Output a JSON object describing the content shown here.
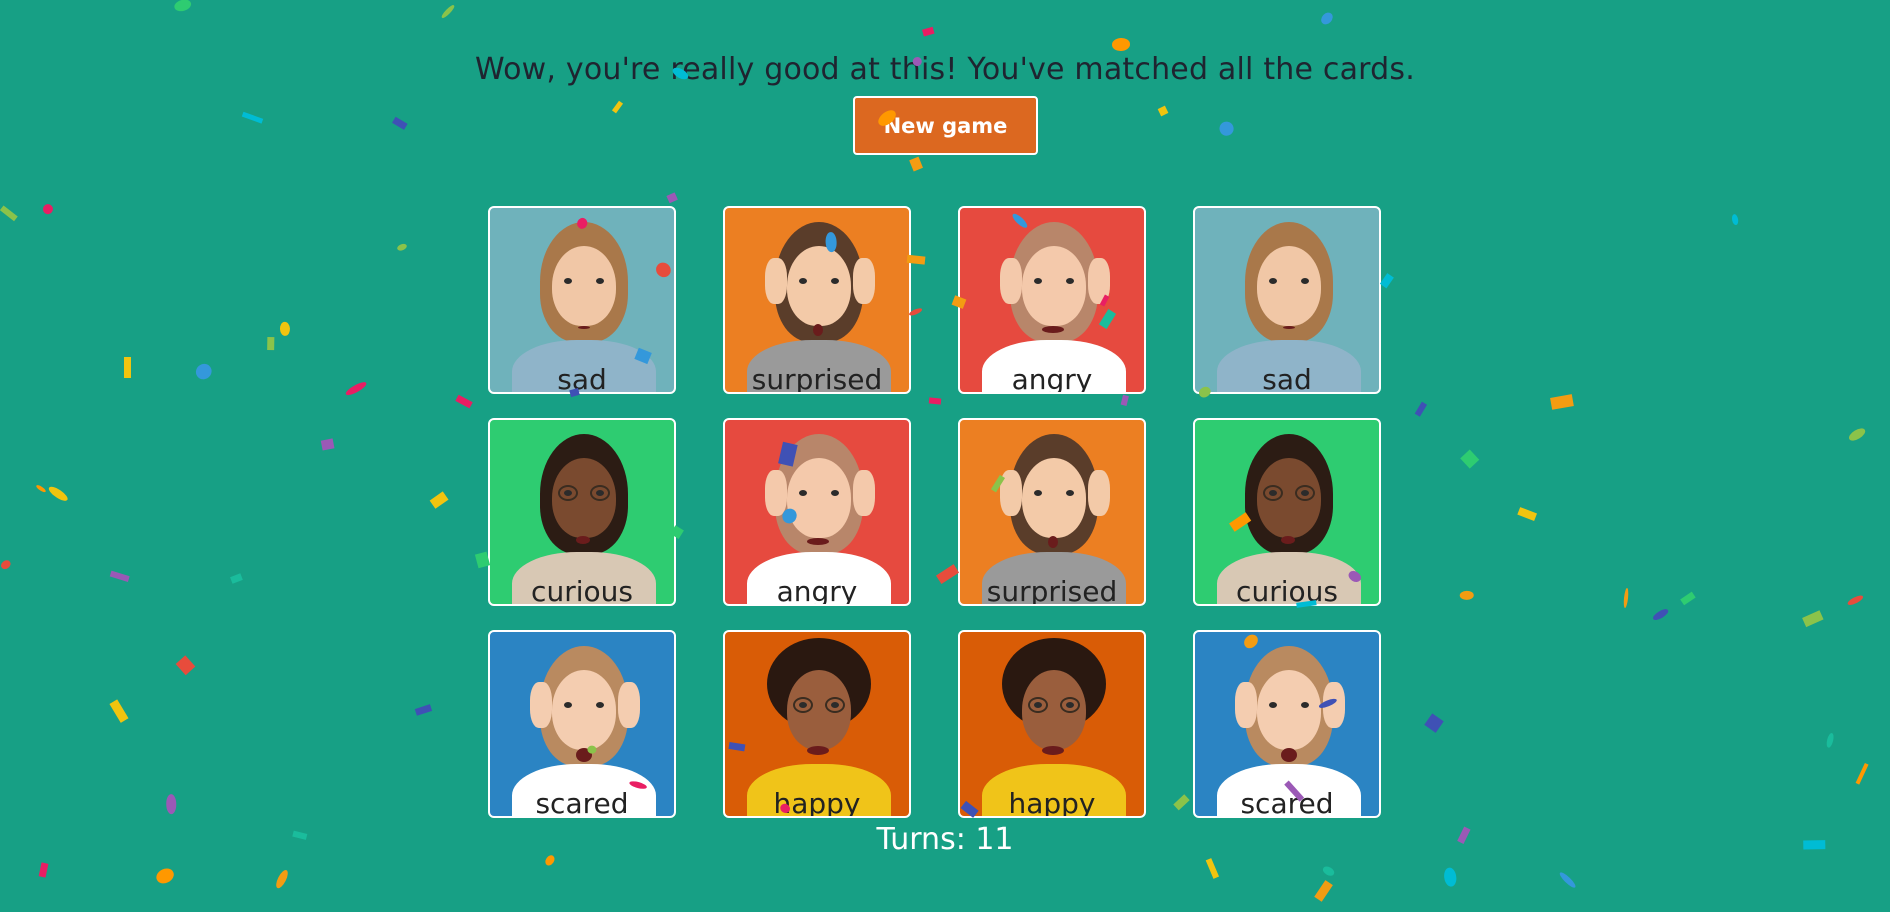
{
  "message": "Wow, you're really good at this! You've matched all the cards.",
  "new_game_label": "New game",
  "turns_label": "Turns: 11",
  "colors": {
    "background": "#17a085",
    "button": "#dc6820",
    "text_dark": "#1f2430",
    "card_border": "#ffffff"
  },
  "cards": [
    {
      "label": "sad",
      "bg": "#6fb2bb",
      "kind": "girl-sad",
      "matched": true
    },
    {
      "label": "surprised",
      "bg": "#ec7f22",
      "kind": "boy-surprised",
      "matched": true
    },
    {
      "label": "angry",
      "bg": "#e64a3f",
      "kind": "girl-angry",
      "matched": true
    },
    {
      "label": "sad",
      "bg": "#6fb2bb",
      "kind": "girl-sad",
      "matched": true
    },
    {
      "label": "curious",
      "bg": "#2ecc71",
      "kind": "man-curious",
      "matched": true
    },
    {
      "label": "angry",
      "bg": "#e64a3f",
      "kind": "girl-angry",
      "matched": true
    },
    {
      "label": "surprised",
      "bg": "#ec7f22",
      "kind": "boy-surprised",
      "matched": true
    },
    {
      "label": "curious",
      "bg": "#2ecc71",
      "kind": "man-curious",
      "matched": true
    },
    {
      "label": "scared",
      "bg": "#2b84c3",
      "kind": "boy-scared",
      "matched": true
    },
    {
      "label": "happy",
      "bg": "#d95c06",
      "kind": "woman-happy",
      "matched": true
    },
    {
      "label": "happy",
      "bg": "#d95c06",
      "kind": "woman-happy",
      "matched": true
    },
    {
      "label": "scared",
      "bg": "#2b84c3",
      "kind": "boy-scared",
      "matched": true
    }
  ]
}
